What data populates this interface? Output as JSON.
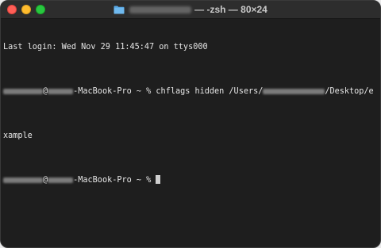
{
  "window": {
    "title_suffix": "— -zsh — 80×24",
    "icon": "folder-icon"
  },
  "terminal": {
    "last_login": "Last login: Wed Nov 29 11:45:47 on ttys000",
    "prompt1_at": "@",
    "prompt1_host": "-MacBook-Pro ~ % ",
    "command": "chflags hidden /Users/",
    "command_path": "/Desktop/e",
    "wrap_line": "xample",
    "prompt2_at": "@",
    "prompt2_host": "-MacBook-Pro ~ % "
  },
  "colors": {
    "background": "#1e1e1e",
    "titlebar": "#2d2d2d",
    "text": "#e6e6e6",
    "close": "#ff5f57",
    "minimize": "#febc2e",
    "maximize": "#28c840"
  }
}
